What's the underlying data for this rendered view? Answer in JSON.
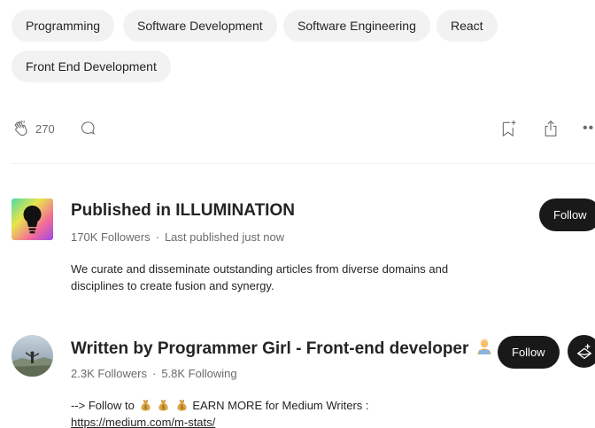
{
  "tags": [
    "Programming",
    "Software Development",
    "Software Engineering",
    "React",
    "Front End Development"
  ],
  "actions": {
    "clap_count": "270"
  },
  "publication": {
    "heading": "Published in ILLUMINATION",
    "followers": "170K Followers",
    "last_published": "Last published just now",
    "description": "We curate and disseminate outstanding articles from diverse domains and disciplines to create fusion and synergy.",
    "follow_label": "Follow"
  },
  "author": {
    "heading": "Written by Programmer Girl - Front-end developer",
    "followers": "2.3K Followers",
    "following": "5.8K Following",
    "bio_prefix": "--> Follow to",
    "bio_suffix": "EARN MORE for Medium Writers :",
    "bio_link": "https://medium.com/m-stats/",
    "follow_label": "Follow"
  },
  "separator": "·",
  "colors": {
    "tag_bg": "#f2f2f2",
    "button_bg": "#191919",
    "muted_text": "#6b6b6b"
  },
  "icons": [
    "clap-icon",
    "comment-icon",
    "bookmark-add-icon",
    "share-icon",
    "more-icon",
    "lightbulb-logo",
    "person-emoji",
    "money-bag-icon",
    "subscribe-mail-icon"
  ]
}
